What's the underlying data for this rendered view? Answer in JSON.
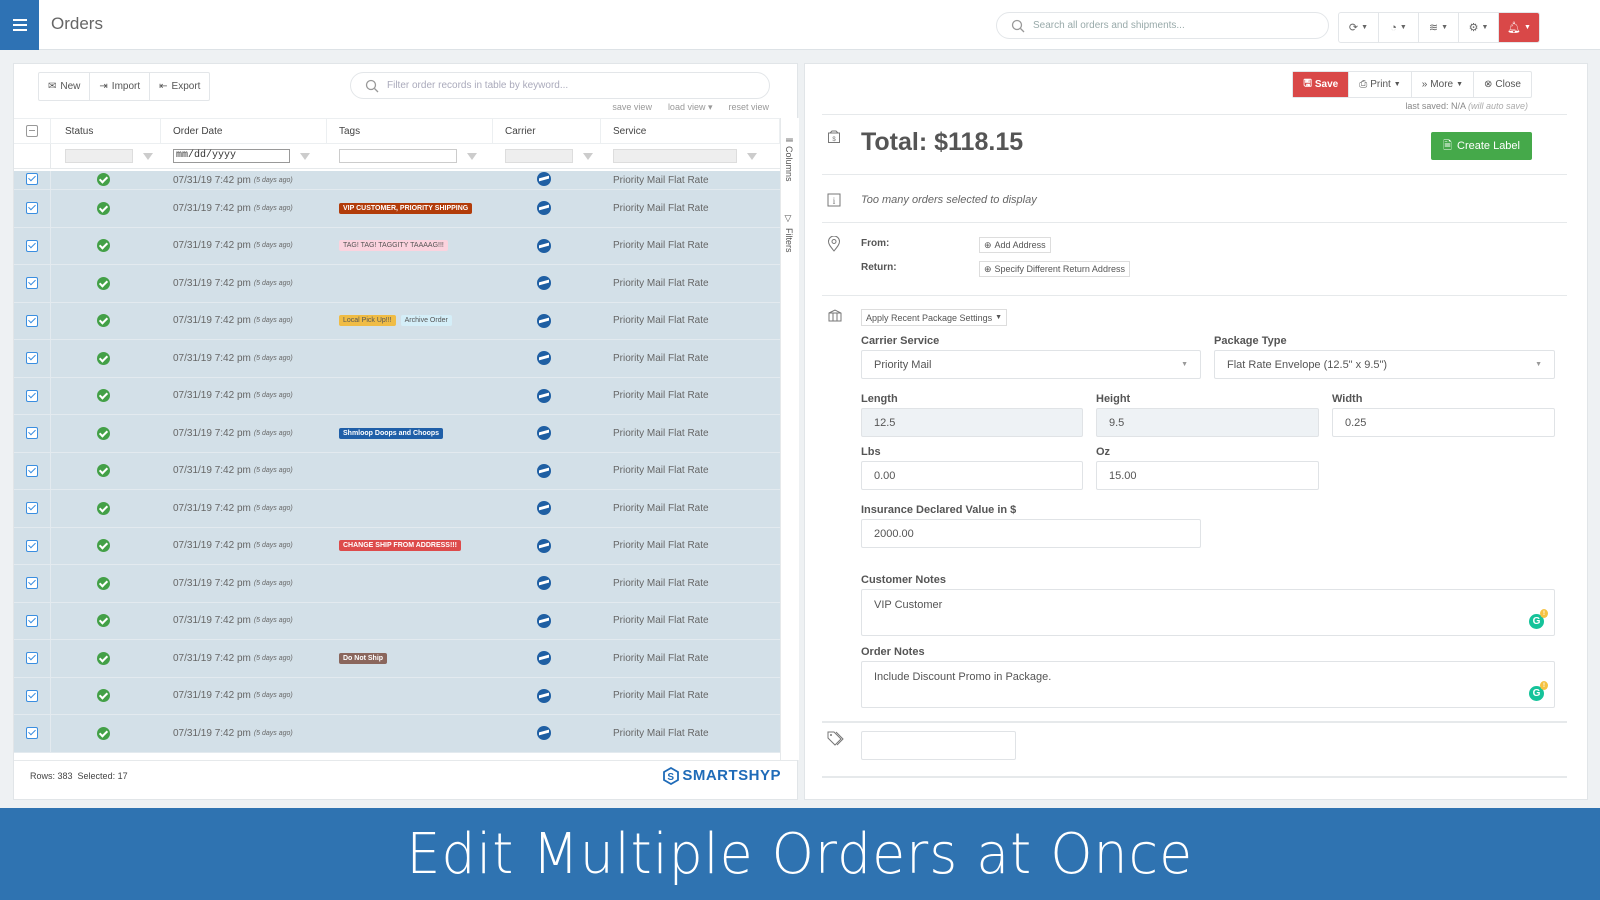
{
  "header": {
    "title": "Orders",
    "search_placeholder": "Search all orders and shipments...",
    "tools": [
      {
        "icon": "refresh-icon"
      },
      {
        "icon": "pie-chart-icon"
      },
      {
        "icon": "layers-icon"
      },
      {
        "icon": "gear-icon"
      },
      {
        "icon": "bell-icon",
        "color": "#d94848"
      }
    ]
  },
  "orders_panel": {
    "toolbar": {
      "new_label": "New",
      "import_label": "Import",
      "export_label": "Export"
    },
    "filter_placeholder": "Filter order records in table by keyword...",
    "view_links": {
      "save": "save view",
      "load": "load view ▾",
      "reset": "reset view"
    },
    "columns": [
      "Status",
      "Order Date",
      "Tags",
      "Carrier",
      "Service"
    ],
    "date_filter_value": "mm/dd/yyyy",
    "side_tabs": {
      "columns": "Columns",
      "filters": "Filters"
    },
    "rows": [
      {
        "date": "07/31/19 7:42 pm",
        "ago": "(5 days ago)",
        "tags": [],
        "service": "Priority Mail Flat Rate"
      },
      {
        "date": "07/31/19 7:42 pm",
        "ago": "(5 days ago)",
        "tags": [
          {
            "text": "VIP CUSTOMER, PRIORITY SHIPPING",
            "bg": "#b23c0a",
            "fg": "#ffffff"
          }
        ],
        "service": "Priority Mail Flat Rate"
      },
      {
        "date": "07/31/19 7:42 pm",
        "ago": "(5 days ago)",
        "tags": [
          {
            "text": "TAG! TAG! TAGGITY TAAAAG!!!",
            "bg": "#fbd3de",
            "fg": "#555555",
            "light": true
          }
        ],
        "service": "Priority Mail Flat Rate"
      },
      {
        "date": "07/31/19 7:42 pm",
        "ago": "(5 days ago)",
        "tags": [],
        "service": "Priority Mail Flat Rate"
      },
      {
        "date": "07/31/19 7:42 pm",
        "ago": "(5 days ago)",
        "tags": [
          {
            "text": "Local Pick Up!!!",
            "bg": "#f0bc45",
            "fg": "#555555",
            "light": true
          },
          {
            "text": "Archive Order",
            "bg": "#d4eef8",
            "fg": "#555555",
            "light": true
          }
        ],
        "service": "Priority Mail Flat Rate"
      },
      {
        "date": "07/31/19 7:42 pm",
        "ago": "(5 days ago)",
        "tags": [],
        "service": "Priority Mail Flat Rate"
      },
      {
        "date": "07/31/19 7:42 pm",
        "ago": "(5 days ago)",
        "tags": [],
        "service": "Priority Mail Flat Rate"
      },
      {
        "date": "07/31/19 7:42 pm",
        "ago": "(5 days ago)",
        "tags": [
          {
            "text": "Shmloop Doops and Choops",
            "bg": "#1f5fa8",
            "fg": "#ffffff"
          }
        ],
        "service": "Priority Mail Flat Rate"
      },
      {
        "date": "07/31/19 7:42 pm",
        "ago": "(5 days ago)",
        "tags": [],
        "service": "Priority Mail Flat Rate"
      },
      {
        "date": "07/31/19 7:42 pm",
        "ago": "(5 days ago)",
        "tags": [],
        "service": "Priority Mail Flat Rate"
      },
      {
        "date": "07/31/19 7:42 pm",
        "ago": "(5 days ago)",
        "tags": [
          {
            "text": "CHANGE SHIP FROM ADDRESS!!!",
            "bg": "#dd4b4b",
            "fg": "#ffffff"
          }
        ],
        "service": "Priority Mail Flat Rate"
      },
      {
        "date": "07/31/19 7:42 pm",
        "ago": "(5 days ago)",
        "tags": [],
        "service": "Priority Mail Flat Rate"
      },
      {
        "date": "07/31/19 7:42 pm",
        "ago": "(5 days ago)",
        "tags": [],
        "service": "Priority Mail Flat Rate"
      },
      {
        "date": "07/31/19 7:42 pm",
        "ago": "(5 days ago)",
        "tags": [
          {
            "text": "Do Not Ship",
            "bg": "#8a665c",
            "fg": "#ffffff"
          }
        ],
        "service": "Priority Mail Flat Rate"
      },
      {
        "date": "07/31/19 7:42 pm",
        "ago": "(5 days ago)",
        "tags": [],
        "service": "Priority Mail Flat Rate"
      },
      {
        "date": "07/31/19 7:42 pm",
        "ago": "(5 days ago)",
        "tags": [],
        "service": "Priority Mail Flat Rate"
      }
    ],
    "footer": {
      "rows_label": "Rows: 383",
      "selected_label": "Selected: 17"
    },
    "brand": "SMARTSHYP"
  },
  "detail_panel": {
    "actions": {
      "save": "Save",
      "print": "Print",
      "more": "More",
      "close": "Close"
    },
    "last_saved": "last saved: N/A",
    "auto_save": "(will auto save)",
    "total": "Total: $118.15",
    "create_label": "Create Label",
    "info_message": "Too many orders selected to display",
    "from_label": "From:",
    "return_label": "Return:",
    "add_address": "Add Address",
    "return_address": "Specify Different Return Address",
    "recent_package": "Apply Recent Package Settings",
    "carrier_service": {
      "label": "Carrier Service",
      "value": "Priority Mail"
    },
    "package_type": {
      "label": "Package Type",
      "value": "Flat Rate Envelope (12.5\" x 9.5\")"
    },
    "length": {
      "label": "Length",
      "value": "12.5"
    },
    "height": {
      "label": "Height",
      "value": "9.5"
    },
    "width": {
      "label": "Width",
      "value": "0.25"
    },
    "lbs": {
      "label": "Lbs",
      "value": "0.00"
    },
    "oz": {
      "label": "Oz",
      "value": "15.00"
    },
    "insurance": {
      "label": "Insurance Declared Value in $",
      "value": "2000.00"
    },
    "customer_notes": {
      "label": "Customer Notes",
      "value": "VIP Customer"
    },
    "order_notes": {
      "label": "Order Notes",
      "value": "Include Discount Promo in Package."
    },
    "tags_value": ""
  },
  "banner": {
    "text": "Edit Multiple Orders at Once"
  },
  "colors": {
    "brand_blue": "#2e72b4",
    "danger": "#d94848",
    "success": "#45a94a",
    "selected_row": "#d3e0e8"
  }
}
